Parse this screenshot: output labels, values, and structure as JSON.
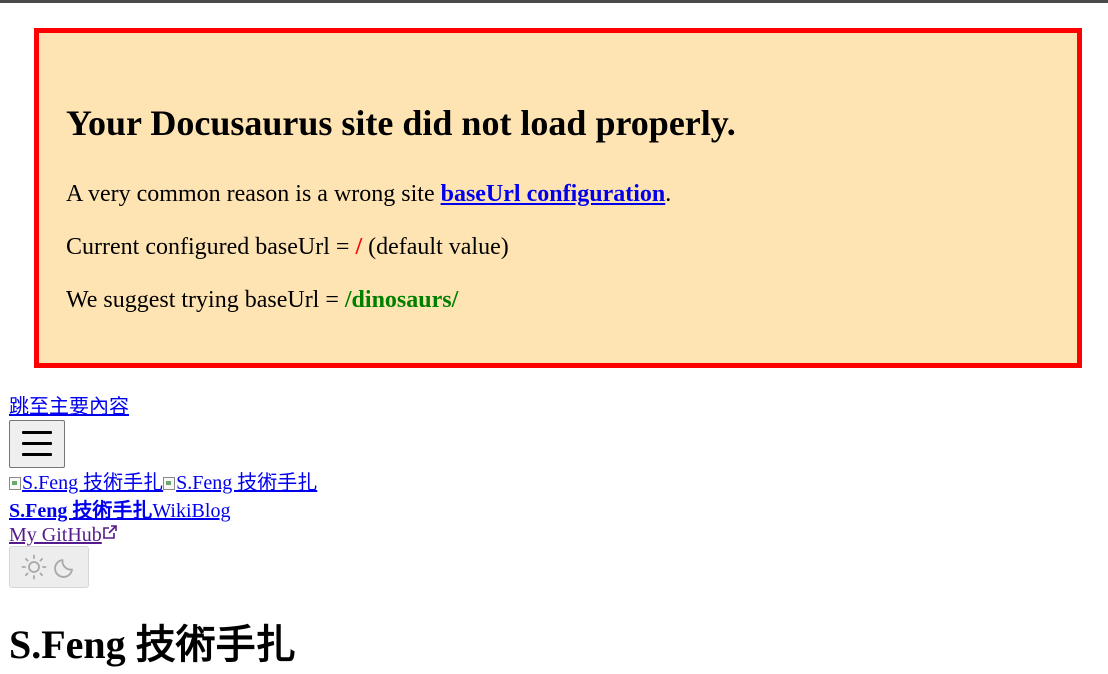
{
  "banner": {
    "heading": "Your Docusaurus site did not load properly.",
    "reason_prefix": "A very common reason is a wrong site ",
    "reason_link": "baseUrl configuration",
    "reason_suffix": ".",
    "current_prefix": "Current configured baseUrl = ",
    "current_value": "/",
    "current_suffix": " (default value)",
    "suggest_prefix": "We suggest trying baseUrl = ",
    "suggest_value": "/dinosaurs/",
    "border_color": "#ff0000",
    "background_color": "#ffe4b3"
  },
  "skip_link": "跳至主要內容",
  "menu_button": {
    "icon": "hamburger-icon"
  },
  "logos": [
    {
      "alt": "S.Feng 技術手扎",
      "icon": "broken-image-icon"
    },
    {
      "alt": "S.Feng 技術手扎",
      "icon": "broken-image-icon"
    }
  ],
  "nav": {
    "brand": "S.Feng 技術手扎",
    "items": [
      "Wiki",
      "Blog"
    ],
    "github": "My GitHub",
    "github_icon": "external-link-icon"
  },
  "theme_toggle": {
    "icons": [
      "sun-icon",
      "moon-icon"
    ]
  },
  "page_title": "S.Feng 技術手扎"
}
